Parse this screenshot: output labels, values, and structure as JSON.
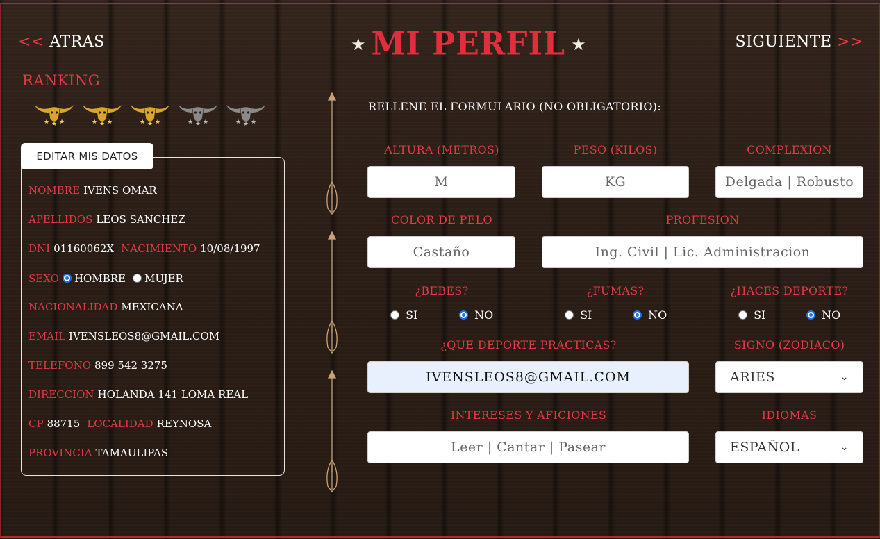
{
  "nav": {
    "back_arrows": "<<",
    "back_label": "ATRAS",
    "next_label": "SIGUIENTE",
    "next_arrows": ">>"
  },
  "header": {
    "star_left": "★",
    "title": "MI PERFIL",
    "star_right": "★"
  },
  "ranking": {
    "label": "RANKING",
    "stars_filled": 3,
    "stars_total": 5
  },
  "profile": {
    "edit_button": "EDITAR MIS DATOS",
    "nombre_label": "NOMBRE",
    "nombre": "IVENS OMAR",
    "apellidos_label": "APELLIDOS",
    "apellidos": "LEOS SANCHEZ",
    "dni_label": "DNI",
    "dni": "01160062X",
    "nacimiento_label": "NACIMIENTO",
    "nacimiento": "10/08/1997",
    "sexo_label": "SEXO",
    "sexo_hombre": "HOMBRE",
    "sexo_mujer": "MUJER",
    "nacionalidad_label": "NACIONALIDAD",
    "nacionalidad": "MEXICANA",
    "email_label": "EMAIL",
    "email": "IVENSLEOS8@GMAIL.COM",
    "telefono_label": "TELEFONO",
    "telefono": "899 542 3275",
    "direccion_label": "DIRECCION",
    "direccion": "HOLANDA 141 LOMA REAL",
    "cp_label": "CP",
    "cp": "88715",
    "localidad_label": "LOCALIDAD",
    "localidad": "REYNOSA",
    "provincia_label": "PROVINCIA",
    "provincia": "TAMAULIPAS"
  },
  "form": {
    "intro": "RELLENE EL FORMULARIO (NO OBLIGATORIO):",
    "altura_label": "ALTURA (METROS)",
    "altura_placeholder": "M",
    "peso_label": "PESO (KILOS)",
    "peso_placeholder": "KG",
    "complexion_label": "COMPLEXION",
    "complexion_placeholder": "Delgada | Robusto",
    "pelo_label": "COLOR DE PELO",
    "pelo_placeholder": "Castaño",
    "profesion_label": "PROFESION",
    "profesion_placeholder": "Ing. Civil | Lic. Administracion",
    "bebes_label": "¿BEBES?",
    "fumas_label": "¿FUMAS?",
    "deporte_label": "¿HACES DEPORTE?",
    "si": "SI",
    "no": "NO",
    "que_deporte_label": "¿QUE DEPORTE PRACTICAS?",
    "que_deporte_value": "IVENSLEOS8@GMAIL.COM",
    "signo_label": "SIGNO (ZODIACO)",
    "signo_value": "ARIES",
    "intereses_label": "INTERESES Y AFICIONES",
    "intereses_placeholder": "Leer | Cantar | Pasear",
    "idiomas_label": "IDIOMAS",
    "idiomas_value": "ESPAÑOL"
  },
  "colors": {
    "accent_red": "#e23a45",
    "text_white": "#ffffff",
    "wood_dark": "#2a1d15",
    "radio_blue": "#1a73e8"
  }
}
